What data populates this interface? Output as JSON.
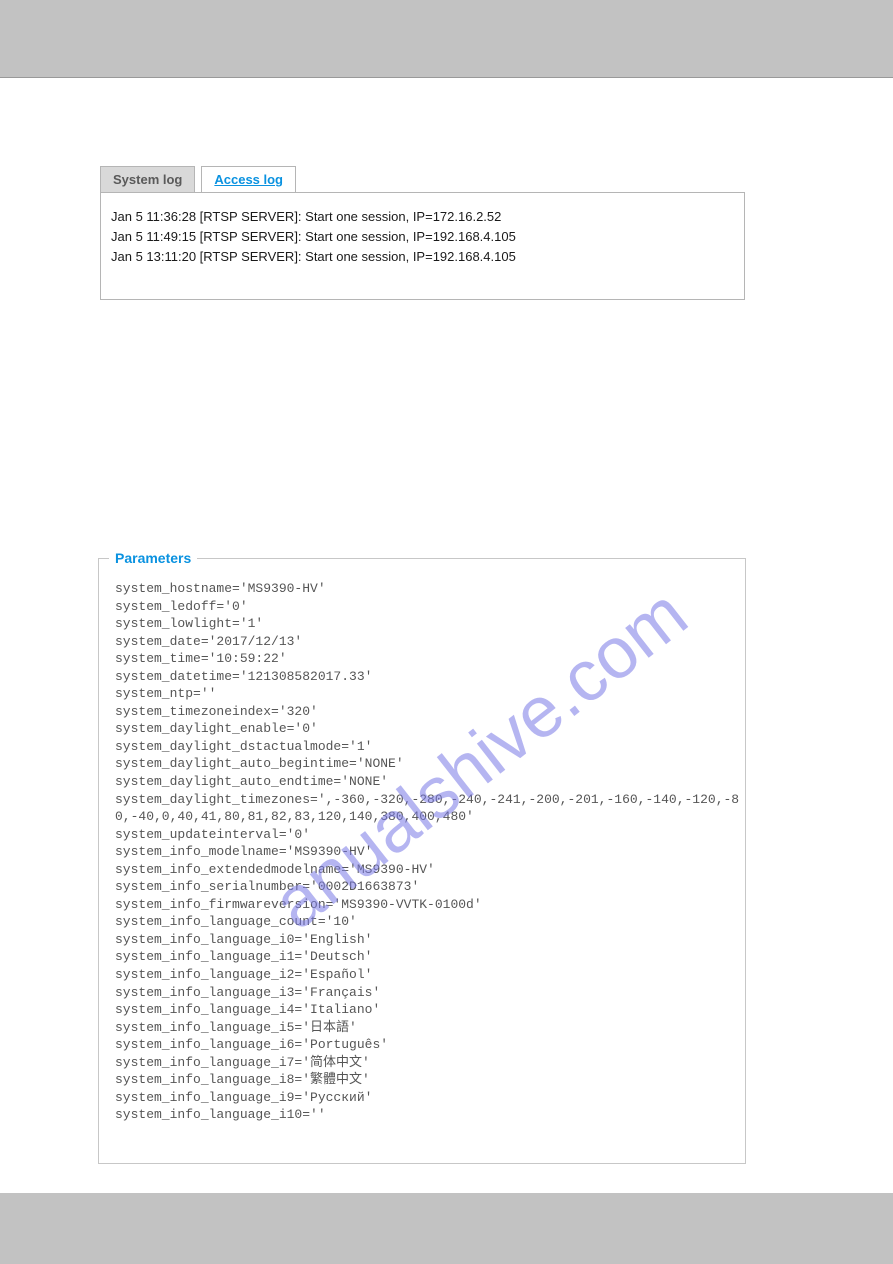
{
  "tabs": {
    "system_log": "System log",
    "access_log": "Access log"
  },
  "log_entries": [
    "Jan 5 11:36:28 [RTSP SERVER]: Start one session, IP=172.16.2.52",
    "Jan 5 11:49:15 [RTSP SERVER]: Start one session, IP=192.168.4.105",
    "Jan 5 13:11:20 [RTSP SERVER]: Start one session, IP=192.168.4.105"
  ],
  "parameters": {
    "legend": "Parameters",
    "lines": [
      "system_hostname='MS9390-HV'",
      "system_ledoff='0'",
      "system_lowlight='1'",
      "system_date='2017/12/13'",
      "system_time='10:59:22'",
      "system_datetime='121308582017.33'",
      "system_ntp=''",
      "system_timezoneindex='320'",
      "system_daylight_enable='0'",
      "system_daylight_dstactualmode='1'",
      "system_daylight_auto_begintime='NONE'",
      "system_daylight_auto_endtime='NONE'",
      "system_daylight_timezones=',-360,-320,-280,-240,-241,-200,-201,-160,-140,-120,-80,-40,0,40,41,80,81,82,83,120,140,380,400,480'",
      "system_updateinterval='0'",
      "system_info_modelname='MS9390-HV'",
      "system_info_extendedmodelname='MS9390-HV'",
      "system_info_serialnumber='0002D1663873'",
      "system_info_firmwareversion='MS9390-VVTK-0100d'",
      "system_info_language_count='10'",
      "system_info_language_i0='English'",
      "system_info_language_i1='Deutsch'",
      "system_info_language_i2='Español'",
      "system_info_language_i3='Français'",
      "system_info_language_i4='Italiano'",
      "system_info_language_i5='日本語'",
      "system_info_language_i6='Português'",
      "system_info_language_i7='简体中文'",
      "system_info_language_i8='繁體中文'",
      "system_info_language_i9='Русский'",
      "system_info_language_i10=''"
    ]
  },
  "watermark": "anualshive.com"
}
